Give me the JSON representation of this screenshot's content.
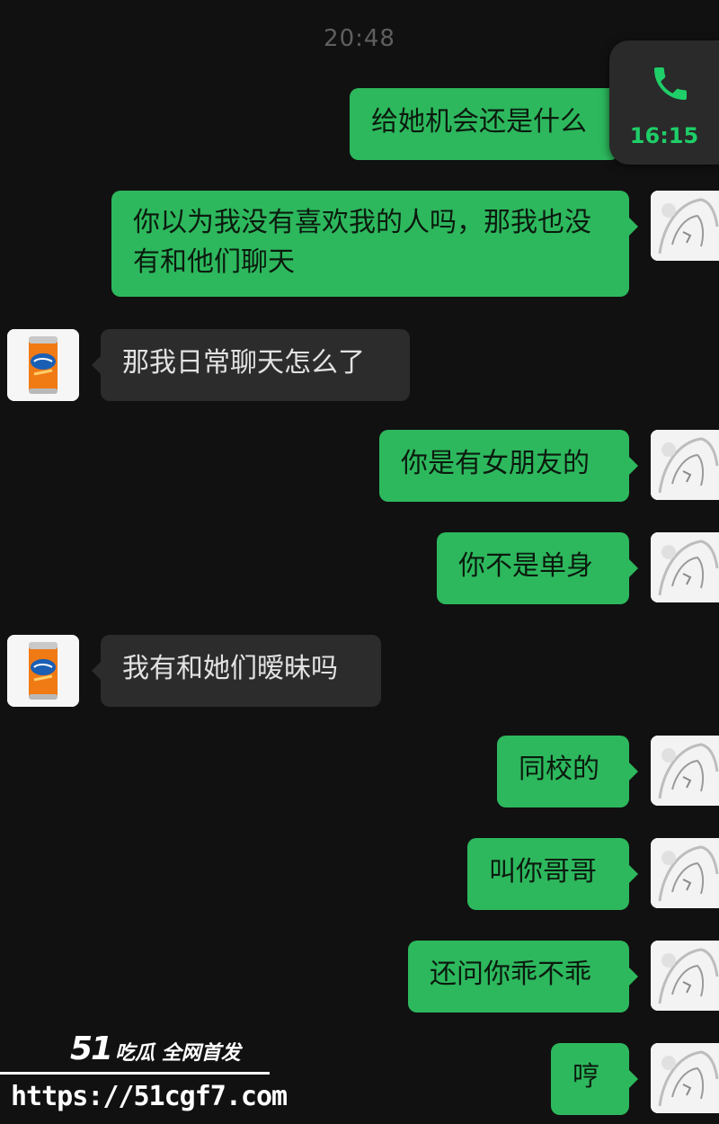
{
  "header": {
    "time": "20:48"
  },
  "call_widget": {
    "duration": "16:15",
    "icon": "phone-icon"
  },
  "messages": [
    {
      "sender": "me",
      "text": "给她机会还是什么"
    },
    {
      "sender": "me",
      "text": "你以为我没有喜欢我的人吗，那我也没有和他们聊天"
    },
    {
      "sender": "other",
      "text": "那我日常聊天怎么了"
    },
    {
      "sender": "me",
      "text": "你是有女朋友的"
    },
    {
      "sender": "me",
      "text": "你不是单身"
    },
    {
      "sender": "other",
      "text": "我有和她们暧昧吗"
    },
    {
      "sender": "me",
      "text": "同校的"
    },
    {
      "sender": "me",
      "text": "叫你哥哥"
    },
    {
      "sender": "me",
      "text": "还问你乖不乖"
    },
    {
      "sender": "me",
      "text": "哼"
    }
  ],
  "watermark": {
    "number": "51",
    "text": "吃瓜 全网首发",
    "url": "https://51cgf7.com"
  },
  "colors": {
    "background": "#111111",
    "outgoing_bubble": "#2db85d",
    "incoming_bubble": "#2c2c2c",
    "call_accent": "#1fce68"
  }
}
